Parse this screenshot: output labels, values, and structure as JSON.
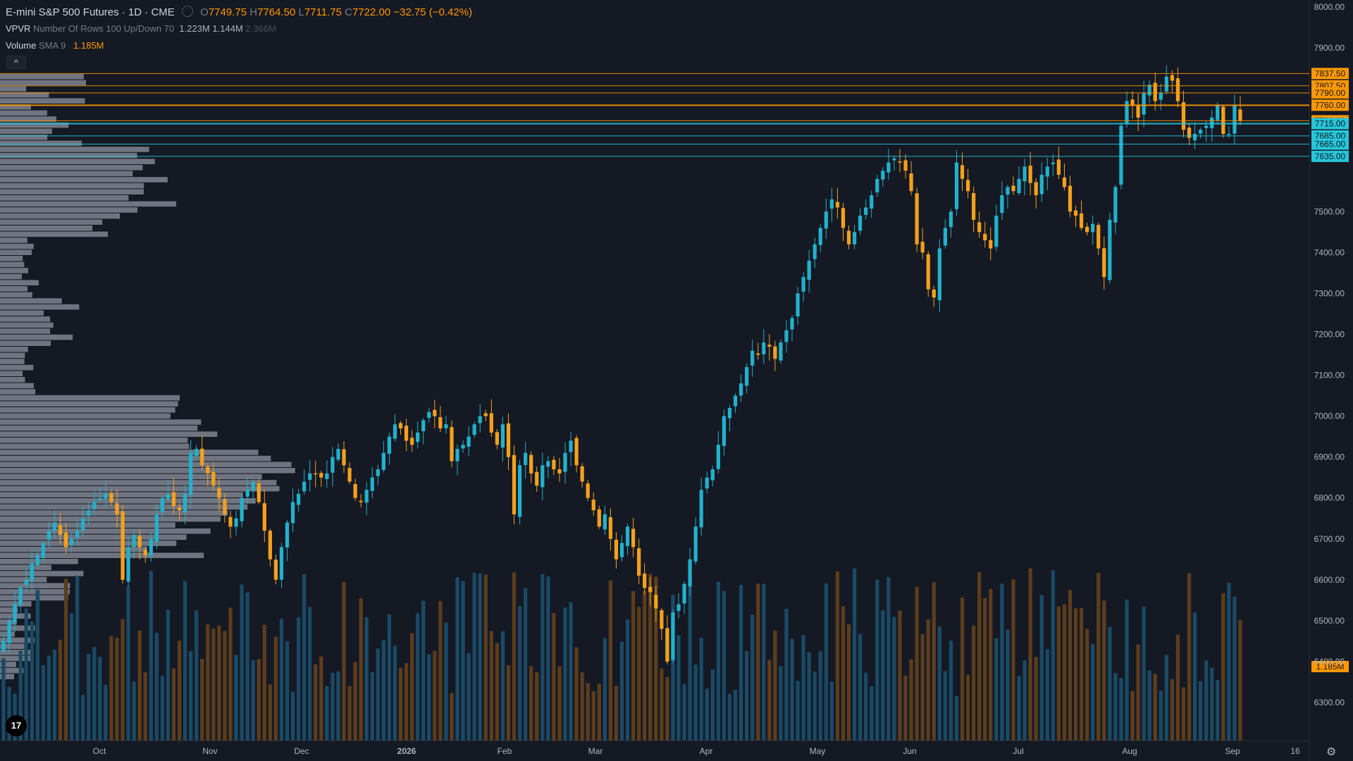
{
  "header": {
    "symbol": "E-mini S&P 500 Futures · 1D · CME",
    "open_label": "O",
    "open": "7749.75",
    "high_label": "H",
    "high": "7764.50",
    "low_label": "L",
    "low": "7711.75",
    "close_label": "C",
    "close": "7722.00",
    "change": "−32.75 (−0.42%)"
  },
  "vpvr": {
    "name": "VPVR",
    "params": "Number Of Rows 100 Up/Down 70",
    "val1": "1.223M",
    "val2": "1.144M",
    "val3": "2.366M"
  },
  "volume_legend": {
    "name": "Volume",
    "params": "SMA 9",
    "value": "1.185M"
  },
  "collapse_icon": "^",
  "logo_text": "17",
  "gear_icon": "⚙",
  "colors": {
    "bg": "#151924",
    "up": "#22b1cc",
    "down": "#f5a01d",
    "vol_up": "#1a4a66",
    "vol_down": "#5c3d1c",
    "vpvr": "#7f8590",
    "text": "#d1d4dc",
    "axis_text": "#b2b5be",
    "orange_level": "#ff9800",
    "cyan_level": "#26c6da"
  },
  "chart_data": {
    "type": "candlestick",
    "title": "E-mini S&P 500 Futures · 1D · CME",
    "y_axis": {
      "range": [
        6230,
        8010
      ],
      "ticks": [
        8000,
        7900,
        7500,
        7400,
        7300,
        7200,
        7100,
        7000,
        6900,
        6800,
        6700,
        6600,
        6500,
        6400,
        6300
      ]
    },
    "x_axis": {
      "labels": [
        "Oct",
        "Nov",
        "Dec",
        "2026",
        "Feb",
        "Mar",
        "Apr",
        "May",
        "Jun",
        "Jul",
        "Aug",
        "Sep",
        "16"
      ],
      "bold_labels": [
        "2026"
      ]
    },
    "price_levels": [
      {
        "price": 7837.5,
        "label": "7837.50",
        "color": "orange"
      },
      {
        "price": 7807.5,
        "label": "7807.50",
        "color": "orange"
      },
      {
        "price": 7790.0,
        "label": "7790.00",
        "color": "orange"
      },
      {
        "price": 7760.0,
        "label": "7760.00",
        "color": "orange"
      },
      {
        "price": 7722.0,
        "label": "7722.00",
        "color": "orange"
      },
      {
        "price": 7715.0,
        "label": "7715.00",
        "color": "cyan"
      },
      {
        "price": 7685.0,
        "label": "7685.00",
        "color": "cyan"
      },
      {
        "price": 7665.0,
        "label": "7665.00",
        "color": "cyan"
      },
      {
        "price": 7635.0,
        "label": "7635.00",
        "color": "cyan"
      }
    ],
    "volume_label": "1.185M",
    "closes": [
      6450,
      6500,
      6540,
      6580,
      6600,
      6640,
      6660,
      6690,
      6720,
      6740,
      6710,
      6680,
      6700,
      6720,
      6750,
      6770,
      6790,
      6800,
      6810,
      6790,
      6760,
      6600,
      6680,
      6710,
      6680,
      6660,
      6700,
      6760,
      6800,
      6810,
      6780,
      6770,
      6810,
      6910,
      6920,
      6880,
      6860,
      6830,
      6800,
      6760,
      6730,
      6750,
      6800,
      6820,
      6840,
      6790,
      6720,
      6650,
      6600,
      6680,
      6740,
      6790,
      6810,
      6840,
      6860,
      6860,
      6850,
      6860,
      6900,
      6920,
      6880,
      6840,
      6800,
      6790,
      6820,
      6850,
      6870,
      6910,
      6950,
      6980,
      6970,
      6940,
      6930,
      6960,
      6990,
      7010,
      7000,
      6970,
      6980,
      6890,
      6920,
      6930,
      6950,
      6980,
      7000,
      7000,
      6960,
      6930,
      6980,
      6900,
      6760,
      6880,
      6910,
      6860,
      6830,
      6880,
      6890,
      6870,
      6860,
      6910,
      6940,
      6880,
      6840,
      6800,
      6770,
      6730,
      6760,
      6700,
      6650,
      6690,
      6730,
      6680,
      6610,
      6580,
      6570,
      6530,
      6480,
      6400,
      6520,
      6540,
      6590,
      6650,
      6730,
      6820,
      6850,
      6870,
      6930,
      7000,
      7020,
      7050,
      7080,
      7120,
      7160,
      7150,
      7180,
      7170,
      7140,
      7180,
      7210,
      7240,
      7300,
      7340,
      7380,
      7420,
      7460,
      7500,
      7530,
      7510,
      7460,
      7420,
      7450,
      7490,
      7510,
      7540,
      7580,
      7600,
      7620,
      7630,
      7620,
      7600,
      7550,
      7420,
      7400,
      7310,
      7290,
      7410,
      7460,
      7500,
      7620,
      7580,
      7550,
      7480,
      7450,
      7430,
      7410,
      7490,
      7540,
      7560,
      7550,
      7580,
      7610,
      7570,
      7540,
      7590,
      7610,
      7620,
      7590,
      7560,
      7500,
      7490,
      7460,
      7450,
      7470,
      7410,
      7340,
      7480,
      7560,
      7710,
      7770,
      7760,
      7730,
      7790,
      7810,
      7770,
      7790,
      7830,
      7820,
      7770,
      7700,
      7680,
      7690,
      7700,
      7710,
      7730,
      7760,
      7690,
      7690,
      7760,
      7722
    ]
  }
}
